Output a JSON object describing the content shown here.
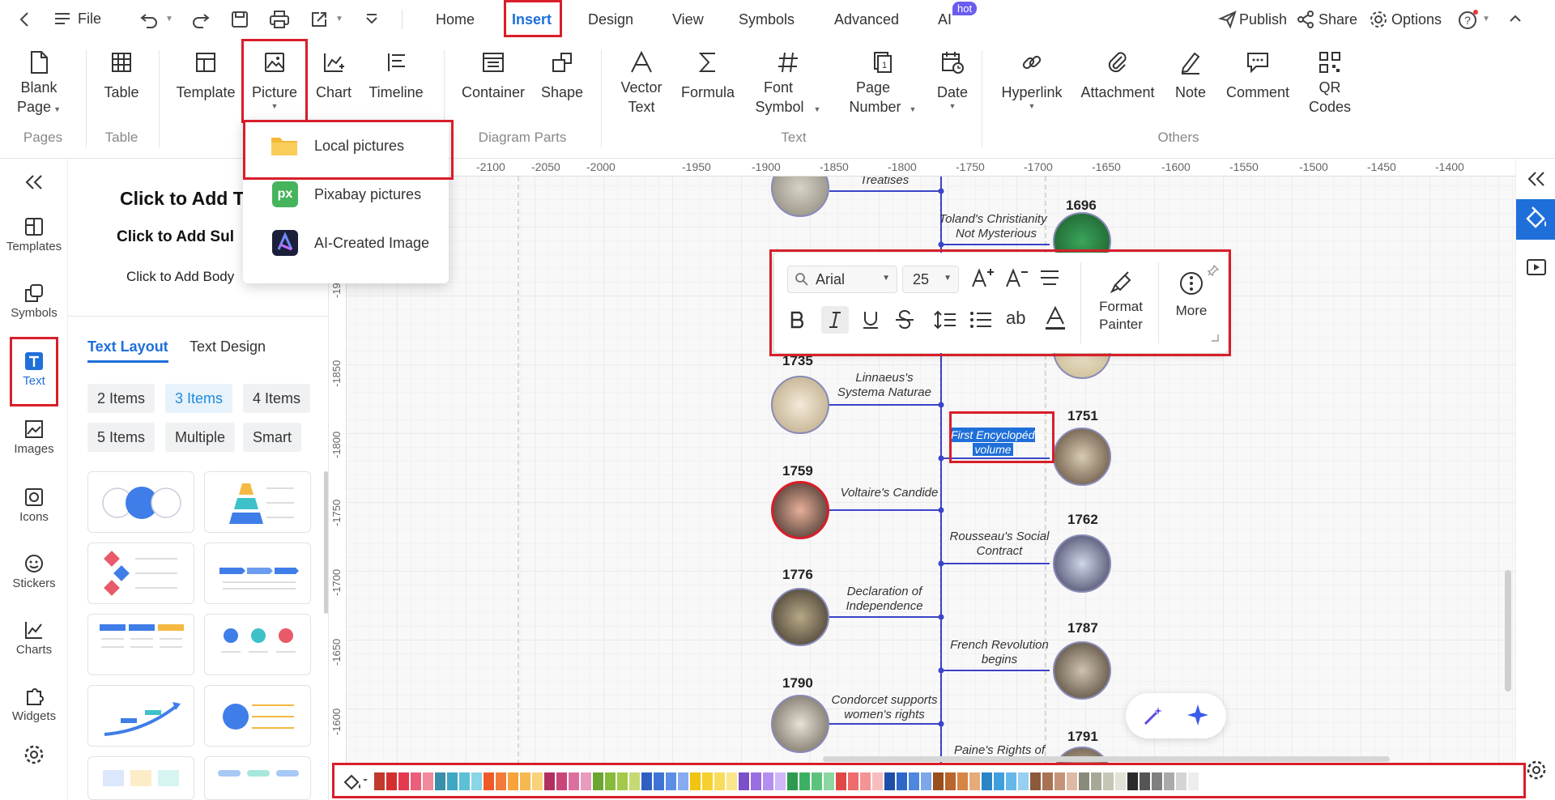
{
  "topbar": {
    "file_label": "File",
    "tabs": [
      "Home",
      "Insert",
      "Design",
      "View",
      "Symbols",
      "Advanced",
      "AI"
    ],
    "ai_badge": "hot",
    "publish_label": "Publish",
    "share_label": "Share",
    "options_label": "Options"
  },
  "ribbon": {
    "buttons": [
      {
        "line1": "Blank",
        "line2": "Page"
      },
      {
        "line1": "Table",
        "line2": ""
      },
      {
        "line1": "Template",
        "line2": ""
      },
      {
        "line1": "Picture",
        "line2": ""
      },
      {
        "line1": "Chart",
        "line2": ""
      },
      {
        "line1": "Timeline",
        "line2": ""
      },
      {
        "line1": "Container",
        "line2": ""
      },
      {
        "line1": "Shape",
        "line2": ""
      },
      {
        "line1": "Vector",
        "line2": "Text"
      },
      {
        "line1": "Formula",
        "line2": ""
      },
      {
        "line1": "Font",
        "line2": "Symbol"
      },
      {
        "line1": "Page",
        "line2": "Number"
      },
      {
        "line1": "Date",
        "line2": ""
      },
      {
        "line1": "Hyperlink",
        "line2": ""
      },
      {
        "line1": "Attachment",
        "line2": ""
      },
      {
        "line1": "Note",
        "line2": ""
      },
      {
        "line1": "Comment",
        "line2": ""
      },
      {
        "line1": "QR",
        "line2": "Codes"
      }
    ],
    "groups": [
      "Pages",
      "Table",
      "Diagram Parts",
      "Text",
      "Others"
    ]
  },
  "picture_menu": {
    "items": [
      "Local pictures",
      "Pixabay pictures",
      "AI-Created Image"
    ],
    "pixabay_icon_text": "px"
  },
  "leftnav": {
    "items": [
      "Templates",
      "Symbols",
      "Text",
      "Images",
      "Icons",
      "Stickers",
      "Charts",
      "Widgets"
    ]
  },
  "panel": {
    "title": "Click to Add T",
    "subtitle": "Click to Add Sul",
    "body": "Click to Add Body",
    "tabs": [
      "Text Layout",
      "Text Design"
    ],
    "chips": [
      "2 Items",
      "3 Items",
      "4 Items",
      "5 Items",
      "Multiple",
      "Smart"
    ]
  },
  "ruler": {
    "h_ticks": [
      "-2100",
      "-2050",
      "-2000",
      "-1950",
      "-1900",
      "-1850",
      "-1800",
      "-1750",
      "-1700",
      "-1650",
      "-1600",
      "-1550",
      "-1500",
      "-1450",
      "-1400"
    ],
    "v_ticks": [
      "-1900",
      "-1850",
      "-1800",
      "-1750",
      "-1700",
      "-1650",
      "-1600"
    ]
  },
  "timeline": {
    "top_partial": "Treatises",
    "events": [
      {
        "year": "1696",
        "label1": "Toland's Christianity",
        "label2": "Not Mysterious"
      },
      {
        "year": "1735",
        "label1": "Linnaeus's",
        "label2": "Systema Naturae"
      },
      {
        "year": "1751",
        "label1": "First Encyclopédie",
        "label2": "volume"
      },
      {
        "year": "1759",
        "label1": "Voltaire's Candide",
        "label2": ""
      },
      {
        "year": "1762",
        "label1": "Rousseau's Social",
        "label2": "Contract"
      },
      {
        "year": "1776",
        "label1": "Declaration of",
        "label2": "Independence"
      },
      {
        "year": "1787",
        "label1": "French Revolution",
        "label2": "begins"
      },
      {
        "year": "1790",
        "label1": "Condorcet supports",
        "label2": "women's rights"
      },
      {
        "year": "1791",
        "label1": "Paine's Rights of",
        "label2": ""
      }
    ]
  },
  "text_toolbar": {
    "font": "Arial",
    "size": "25",
    "format_painter_1": "Format",
    "format_painter_2": "Painter",
    "more_label": "More",
    "ab_label": "ab"
  },
  "palette": [
    "#c0392b",
    "#d32f2f",
    "#e53950",
    "#ec5f7a",
    "#f08a9c",
    "#3a8fa8",
    "#3fa7c2",
    "#5cc0d6",
    "#88d6e6",
    "#f05a28",
    "#f37a3a",
    "#f7a23a",
    "#f6b94f",
    "#f9d27a",
    "#b03060",
    "#c8457a",
    "#dd6fa0",
    "#e99bbd",
    "#6aa631",
    "#86bb3a",
    "#a3c94a",
    "#c5da72",
    "#2f5fbf",
    "#3d74d6",
    "#5c8ee6",
    "#86abef",
    "#f1c40f",
    "#f5d130",
    "#f8dd5c",
    "#fae78c",
    "#7a4fc9",
    "#9a6ee0",
    "#b48ef0",
    "#d0b7f7",
    "#2e9a4f",
    "#3cb062",
    "#5cc37c",
    "#8dd6a2",
    "#e04848",
    "#ee6b6b",
    "#f49494",
    "#f8bcbc",
    "#1f4ea8",
    "#2f67c8",
    "#4f86df",
    "#7ea7ea",
    "#9a4f1f",
    "#b8642c",
    "#d68545",
    "#e7ab78",
    "#2a84c6",
    "#3fa0dd",
    "#66b8e8",
    "#97cff0",
    "#8a5a3a",
    "#a87353",
    "#c59478",
    "#dcbaa4",
    "#8a8a7a",
    "#a8a898",
    "#c6c6b6",
    "#e2e2d6",
    "#2b2b2b",
    "#555555",
    "#808080",
    "#aaaaaa",
    "#d4d4d4",
    "#ededed"
  ]
}
